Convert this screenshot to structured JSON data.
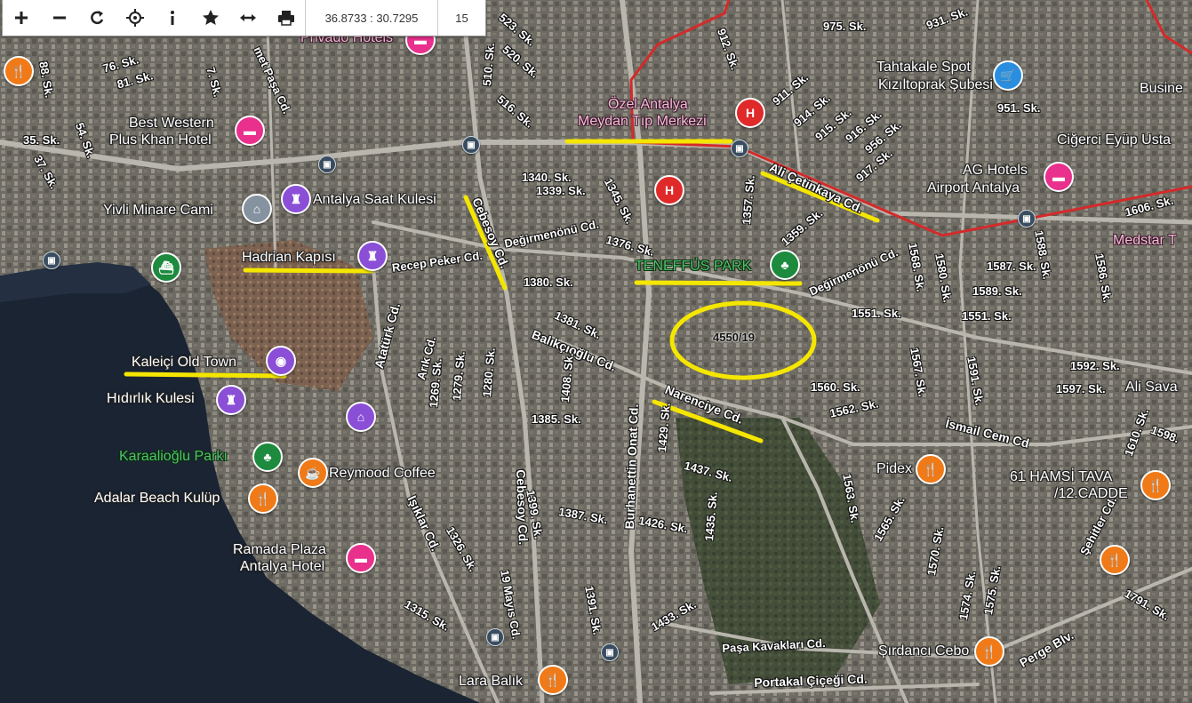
{
  "toolbar": {
    "zoom_in": "+",
    "zoom_out": "−",
    "refresh": "⟳",
    "locate": "⌖",
    "info": "i",
    "favorite": "★",
    "measure": "⟷",
    "print": "⎙",
    "coordinates": "36.8733 : 30.7295",
    "zoom_level": "15"
  },
  "parcel_label": "4550/19",
  "places": {
    "privado": "Privado Hotels",
    "best_western_1": "Best Western",
    "best_western_2": "Plus Khan Hotel",
    "saat_kulesi": "Antalya Saat Kulesi",
    "yivli": "Yivli Minare Cami",
    "hadrian": "Hadrian Kapısı",
    "kaleici": "Kaleiçi Old Town",
    "hidirlik": "Hıdırlık Kulesi",
    "karaalioglu": "Karaalioğlu Parkı",
    "reymood": "Reymood Coffee",
    "adalar": "Adalar Beach Kulüp",
    "ramada_1": "Ramada Plaza",
    "ramada_2": "Antalya Hotel",
    "lara_balik": "Lara Balık",
    "ozel_antalya": "Özel Antalya",
    "meydan": "Meydan Tıp Merkezi",
    "tahtakale_1": "Tahtakale Spot",
    "tahtakale_2": "Kızıltoprak Şubesi",
    "cigerci": "Ciğerci Eyüp Usta",
    "ag_hotels_1": "AG Hotels",
    "ag_hotels_2": "Airport Antalya",
    "teneffus": "TENEFFÜS PARK",
    "medstar": "Medstar T",
    "pidex": "Pidex",
    "hamsi_1": "61 HAMSİ TAVA",
    "hamsi_2": "/12.CADDE",
    "ali_sava": "Ali Sava",
    "sirdanci": "Şırdancı Cebo",
    "busine": "Busine"
  },
  "streets": {
    "ataturk": "Atatürk Cd.",
    "cebesoy": "Cebesoy Cd.",
    "cebesoy2": "Cebesoy Cd.",
    "recep": "Recep Peker Cd.",
    "degirmenonu": "Değirmenönü Cd.",
    "degirmenonu2": "Değirmenönü Cd.",
    "balikcioglu": "Balıkçıoğlu Cd.",
    "burhanettin": "Burhanettin Onat Cd.",
    "narenciye": "Narenciye Cd.",
    "isiklar": "Işıklar Cd.",
    "ali_cetinkaya": "Ali Çetinkaya Cd.",
    "ismail_cem": "İsmail Cem Cd",
    "perge": "Perge Blv.",
    "pasa_kavaklari": "Paşa Kavakları Cd.",
    "portakal": "Portakal Çiçeği Cd.",
    "mayis": "19 Mayıs Cd.",
    "kazim": "met Paşa Cd.",
    "arik": "Arık Cd.",
    "sehitler": "Şehitler Cd.",
    "s1340": "1340. Sk.",
    "s1339": "1339. Sk.",
    "s1380": "1380. Sk.",
    "s1381": "1381. Sk.",
    "s1385": "1385. Sk.",
    "s1387": "1387. Sk.",
    "s1426": "1426. Sk.",
    "s1437": "1437. Sk.",
    "s1433": "1433. Sk.",
    "s1376": "1376. Sk.",
    "s1359": "1359. Sk.",
    "s1357": "1357. Sk.",
    "s1345": "1345. Sk.",
    "s1551": "1551. Sk.",
    "s1551b": "1551. Sk.",
    "s1560": "1560. Sk.",
    "s1562": "1562. Sk.",
    "s1587": "1587. Sk.",
    "s1589": "1589. Sk.",
    "s1592": "1592. Sk.",
    "s1597": "1597. Sk.",
    "s1606": "1606. Sk.",
    "s1315": "1315. Sk.",
    "s1326": "1326. Sk.",
    "s951": "951. Sk.",
    "s975": "975. Sk.",
    "s911": "911. Sk.",
    "s914": "914. Sk.",
    "s915": "915. Sk.",
    "s916": "916. Sk.",
    "s912": "912. Sk.",
    "s956": "956. Sk.",
    "s917": "917. Sk.",
    "s931": "931. Sk.",
    "s520": "520. Sk.",
    "s523": "523. Sk.",
    "s516": "516. Sk.",
    "s510": "510. Sk.",
    "s76": "76. Sk.",
    "s81": "81. Sk.",
    "s88": "88. Sk.",
    "s35": "35. Sk.",
    "s54": "54. Sk.",
    "s37": "37. Sk.",
    "s7": "7. Sk.",
    "s1269": "1269. Sk.",
    "s1279": "1279. Sk.",
    "s1280": "1280. Sk.",
    "s1408": "1408. Sk.",
    "s1429": "1429. Sk.",
    "s1435": "1435. Sk.",
    "s1391": "1391. Sk.",
    "s1399": "1399. Sk.",
    "s1563": "1563. Sk.",
    "s1565": "1565. Sk.",
    "s1570": "1570. Sk.",
    "s1574": "1574. Sk.",
    "s1575": "1575. Sk.",
    "s1567": "1567. Sk.",
    "s1568": "1568. Sk.",
    "s1580": "1580. Sk.",
    "s1591": "1591. Sk.",
    "s1586": "1586. Sk.",
    "s1588": "1588. Sk.",
    "s1610": "1610. Sk.",
    "s1598": "1598.",
    "s1791": "1791. Sk."
  },
  "colors": {
    "highlight": "#f5e600",
    "boundary": "#d42a2a",
    "poi_pink": "#e8308c",
    "poi_purple": "#8a4fd6",
    "poi_orange": "#f07a18",
    "poi_green": "#1d8a3e",
    "poi_red": "#e02a2a",
    "poi_blue": "#2a8ee0",
    "poi_gray": "#8593a0"
  },
  "icons": [
    "plus-icon",
    "minus-icon",
    "refresh-icon",
    "crosshair-icon",
    "info-icon",
    "star-icon",
    "arrows-horizontal-icon",
    "printer-icon",
    "hotel-icon",
    "landmark-icon",
    "restaurant-icon",
    "hospital-icon",
    "park-icon",
    "shopping-cart-icon",
    "camera-icon",
    "bus-stop-icon",
    "ferry-icon",
    "mosque-icon"
  ]
}
